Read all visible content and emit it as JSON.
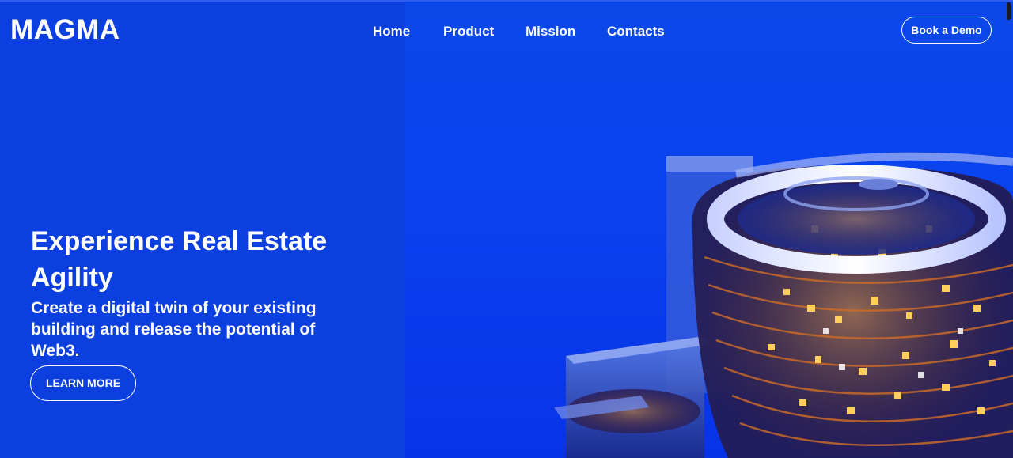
{
  "brand": {
    "logo": "MAGMA"
  },
  "nav": {
    "items": [
      {
        "label": "Home"
      },
      {
        "label": "Product"
      },
      {
        "label": "Mission"
      },
      {
        "label": "Contacts"
      }
    ],
    "cta_label": "Book a Demo"
  },
  "hero": {
    "title": "Experience Real Estate Agility",
    "subtitle": "Create a digital twin of your existing building and release the potential of Web3.",
    "button_label": "LEARN MORE",
    "image_icon": "building-illustration"
  },
  "colors": {
    "background": "#0a3fe0",
    "accent_light": "#f0a030",
    "text": "#ffffff"
  }
}
